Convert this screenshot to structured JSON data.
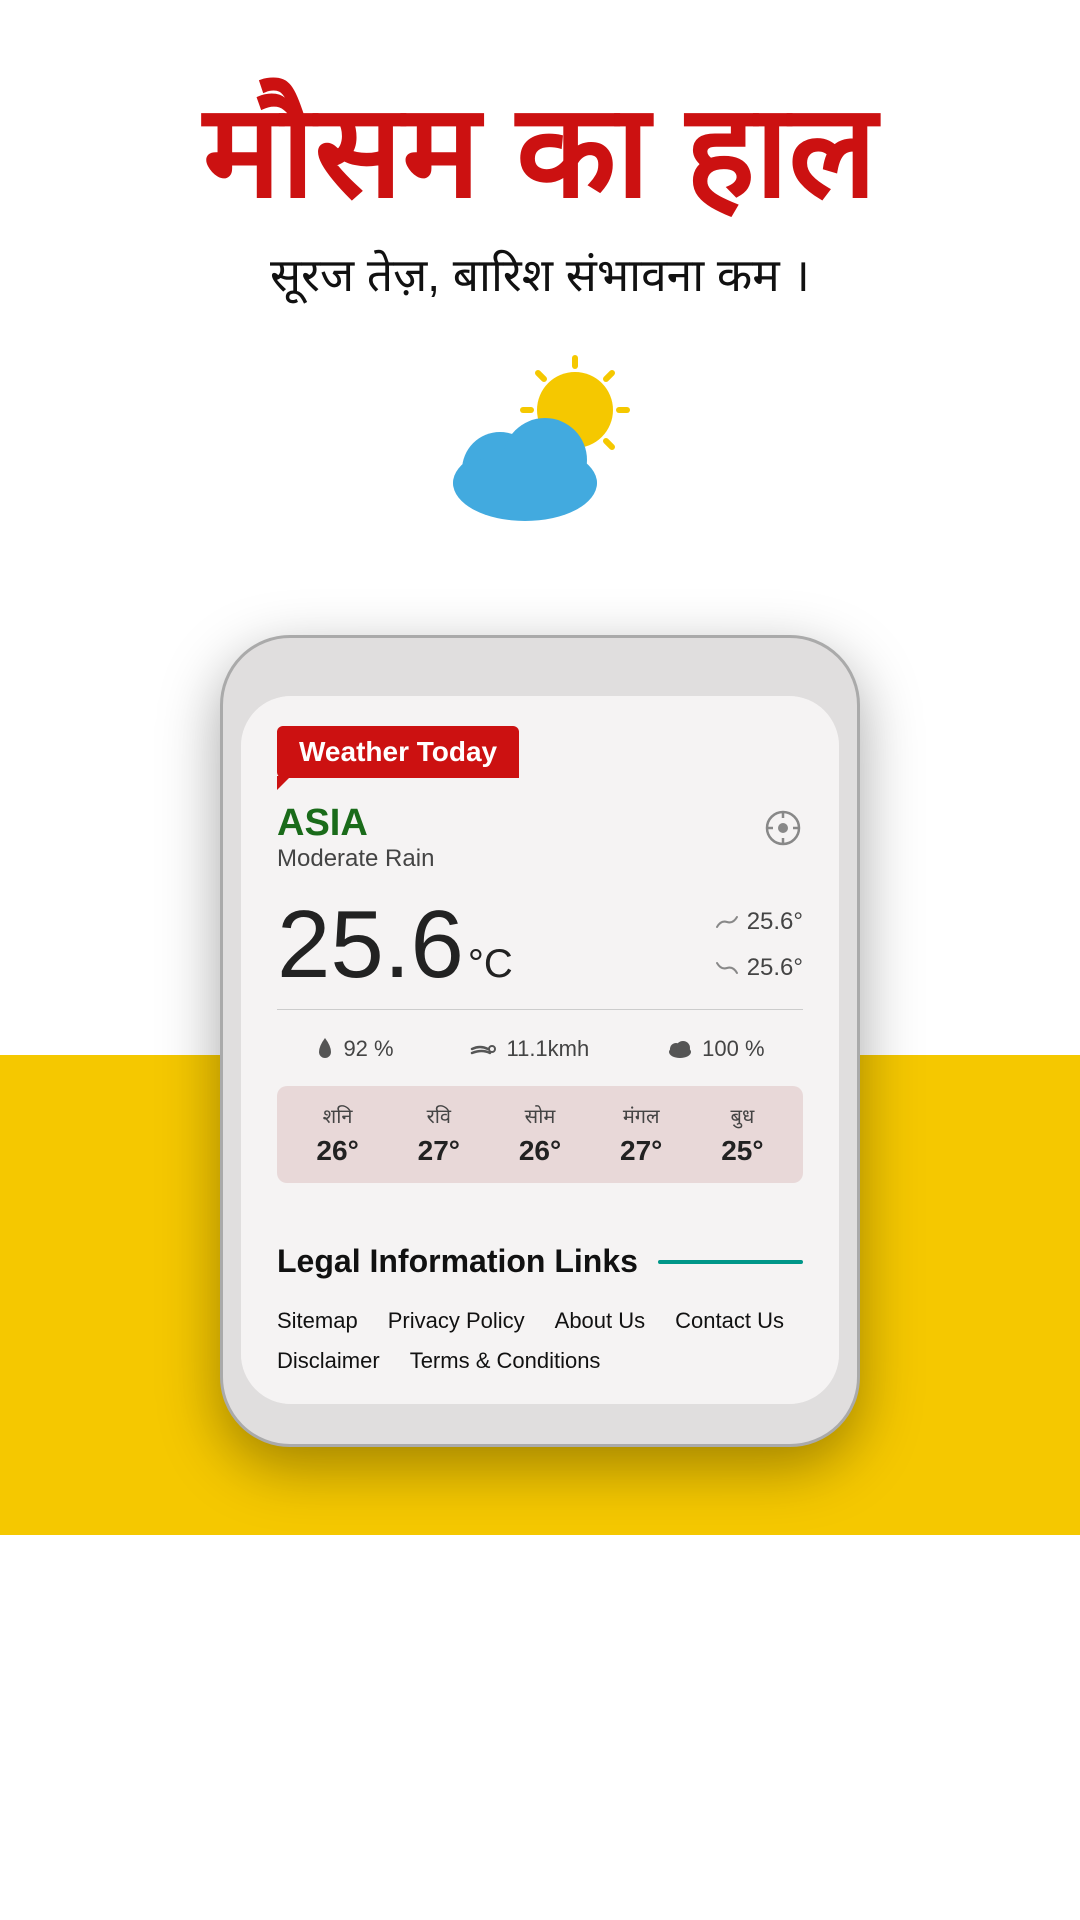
{
  "header": {
    "hindi_title": "मौसम का हाल",
    "hindi_subtitle": "सूरज तेज़, बारिश संभावना कम ।"
  },
  "weather_badge": {
    "label": "Weather Today"
  },
  "location": {
    "name": "ASIA",
    "description": "Moderate Rain",
    "location_icon": "◎"
  },
  "temperature": {
    "main": "25.6",
    "unit": "°C",
    "high": "25.6°",
    "low": "25.6°"
  },
  "stats": {
    "humidity_label": "92 %",
    "wind_label": "11.1kmh",
    "cloud_label": "100 %"
  },
  "forecast": [
    {
      "day": "शनि",
      "temp": "26°"
    },
    {
      "day": "रवि",
      "temp": "27°"
    },
    {
      "day": "सोम",
      "temp": "26°"
    },
    {
      "day": "मंगल",
      "temp": "27°"
    },
    {
      "day": "बुध",
      "temp": "25°"
    }
  ],
  "legal": {
    "title": "Legal Information Links",
    "links": [
      "Sitemap",
      "Privacy Policy",
      "About Us",
      "Contact Us",
      "Disclaimer",
      "Terms & Conditions"
    ]
  }
}
